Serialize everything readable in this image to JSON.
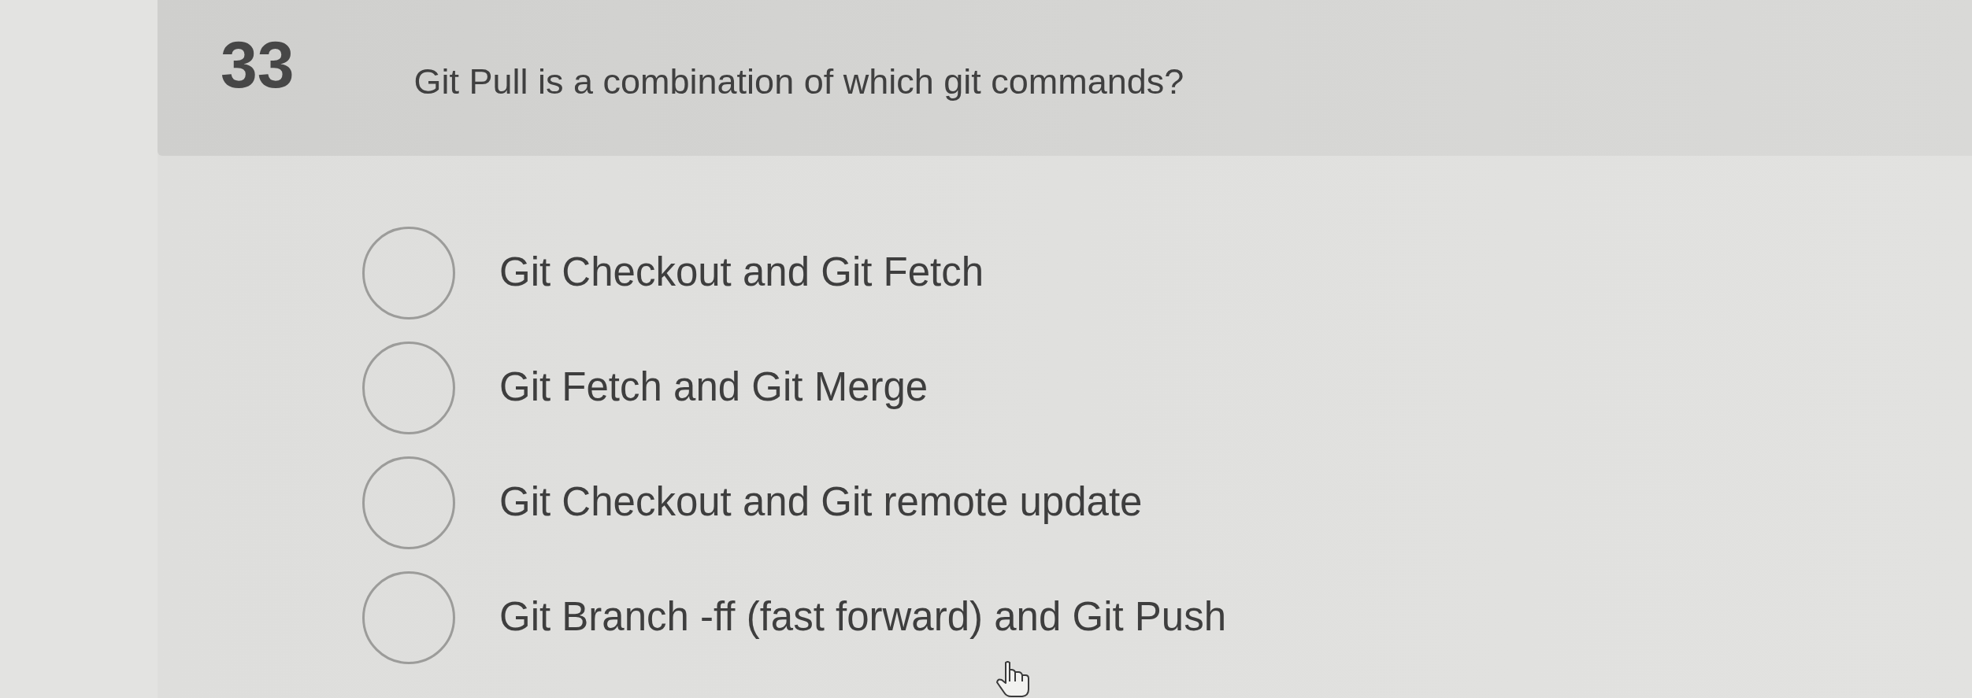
{
  "question": {
    "number": "33",
    "text": "Git Pull is a combination of which git commands?"
  },
  "options": [
    {
      "label": "Git Checkout and Git Fetch",
      "selected": false
    },
    {
      "label": "Git Fetch and Git Merge",
      "selected": false
    },
    {
      "label": "Git Checkout and Git remote update",
      "selected": false
    },
    {
      "label": "Git Branch -ff (fast forward) and Git Push",
      "selected": false
    }
  ]
}
